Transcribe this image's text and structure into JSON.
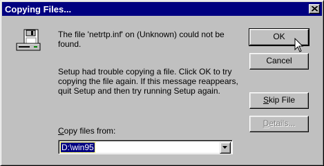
{
  "window": {
    "title": "Copying Files..."
  },
  "message": {
    "line1": "The file 'netrtp.inf' on (Unknown) could not be found.",
    "line2": "Setup had trouble copying a file. Click OK to try copying the file again. If this message reappears, quit Setup and then try running Setup again."
  },
  "copy_from": {
    "label_accel": "C",
    "label_rest": "opy files from:",
    "value": "D:\\win95"
  },
  "buttons": {
    "ok": "OK",
    "cancel": "Cancel",
    "skip_accel": "S",
    "skip_rest": "kip File",
    "details_accel": "D",
    "details_rest": "etails..."
  },
  "icons": {
    "dialog": "disk-drive-icon",
    "close": "close-icon",
    "dropdown": "chevron-down-icon",
    "cursor": "mouse-pointer-icon"
  },
  "colors": {
    "titlebar": "#000080",
    "face": "#c0c0c0",
    "selection": "#000080"
  }
}
